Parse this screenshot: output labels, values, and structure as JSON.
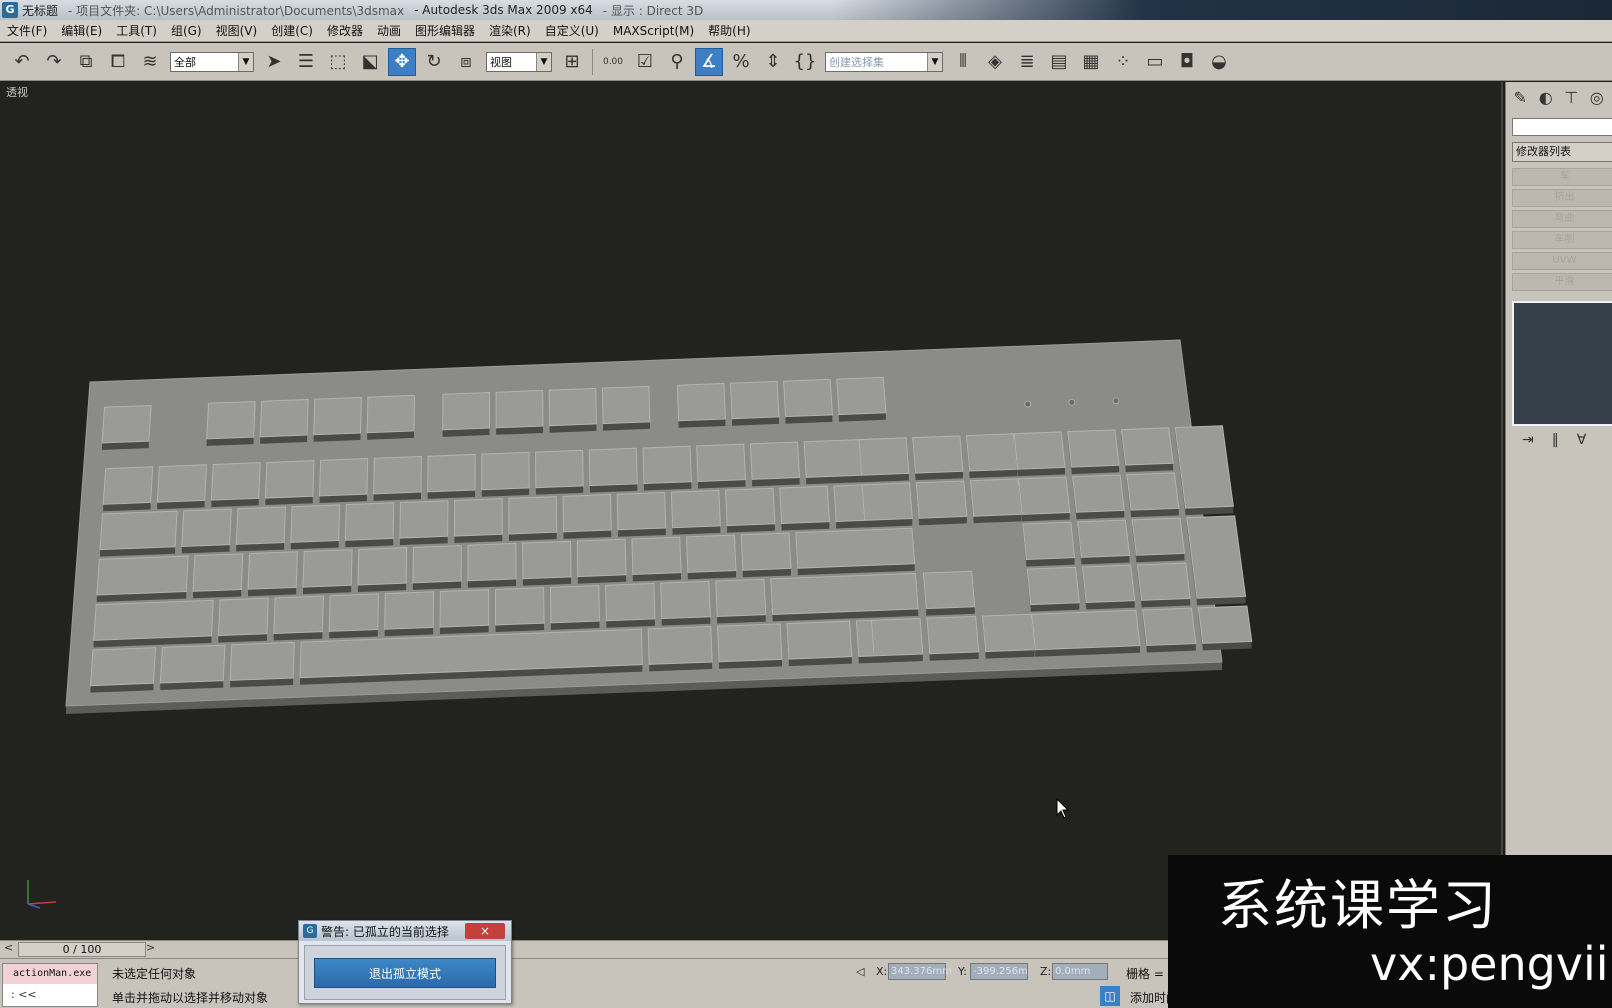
{
  "titlebar": {
    "doc_name": "无标题",
    "project_folder": "- 项目文件夹: C:\\Users\\Administrator\\Documents\\3dsmax",
    "app_name": "- Autodesk 3ds Max  2009 x64",
    "display_mode": "- 显示 : Direct 3D"
  },
  "menubar": {
    "items": [
      "文件(F)",
      "编辑(E)",
      "工具(T)",
      "组(G)",
      "视图(V)",
      "创建(C)",
      "修改器",
      "动画",
      "图形编辑器",
      "渲染(R)",
      "自定义(U)",
      "MAXScript(M)",
      "帮助(H)"
    ]
  },
  "toolbar": {
    "selection_filter": "全部",
    "ref_coord": "视图",
    "named_selection": "创建选择集",
    "snap_label": "0.00"
  },
  "viewport": {
    "label": "透视"
  },
  "command_panel": {
    "modifier_list": "修改器列表",
    "rows": [
      "车",
      "挤出",
      "弯曲",
      "车削",
      "UVW",
      "平滑"
    ]
  },
  "timeline": {
    "slider": "0 / 100",
    "left_arrow": "<",
    "right_arrow": ">"
  },
  "status": {
    "maxscript_top": "actionMan.exe",
    "maxscript_bottom": ":  <<",
    "line1": "未选定任何对象",
    "line2": "单击并拖动以选择并移动对象",
    "x_label": "X:",
    "x_value": "343.376mm",
    "y_label": "Y:",
    "y_value": "-399.256m",
    "z_label": "Z:",
    "z_value": "0.0mm",
    "grid_label": "栅格 =",
    "add_time": "添加时间标"
  },
  "warning_dialog": {
    "title": "警告: 已孤立的当前选择",
    "close": "×",
    "button": "退出孤立模式"
  },
  "watermark": {
    "line1": "系统课学习",
    "line2": "vx:pengvii"
  },
  "colors": {
    "viewport_bg": "#22231f",
    "keyboard": "#8e8f8b",
    "accent": "#3d7fc4"
  }
}
